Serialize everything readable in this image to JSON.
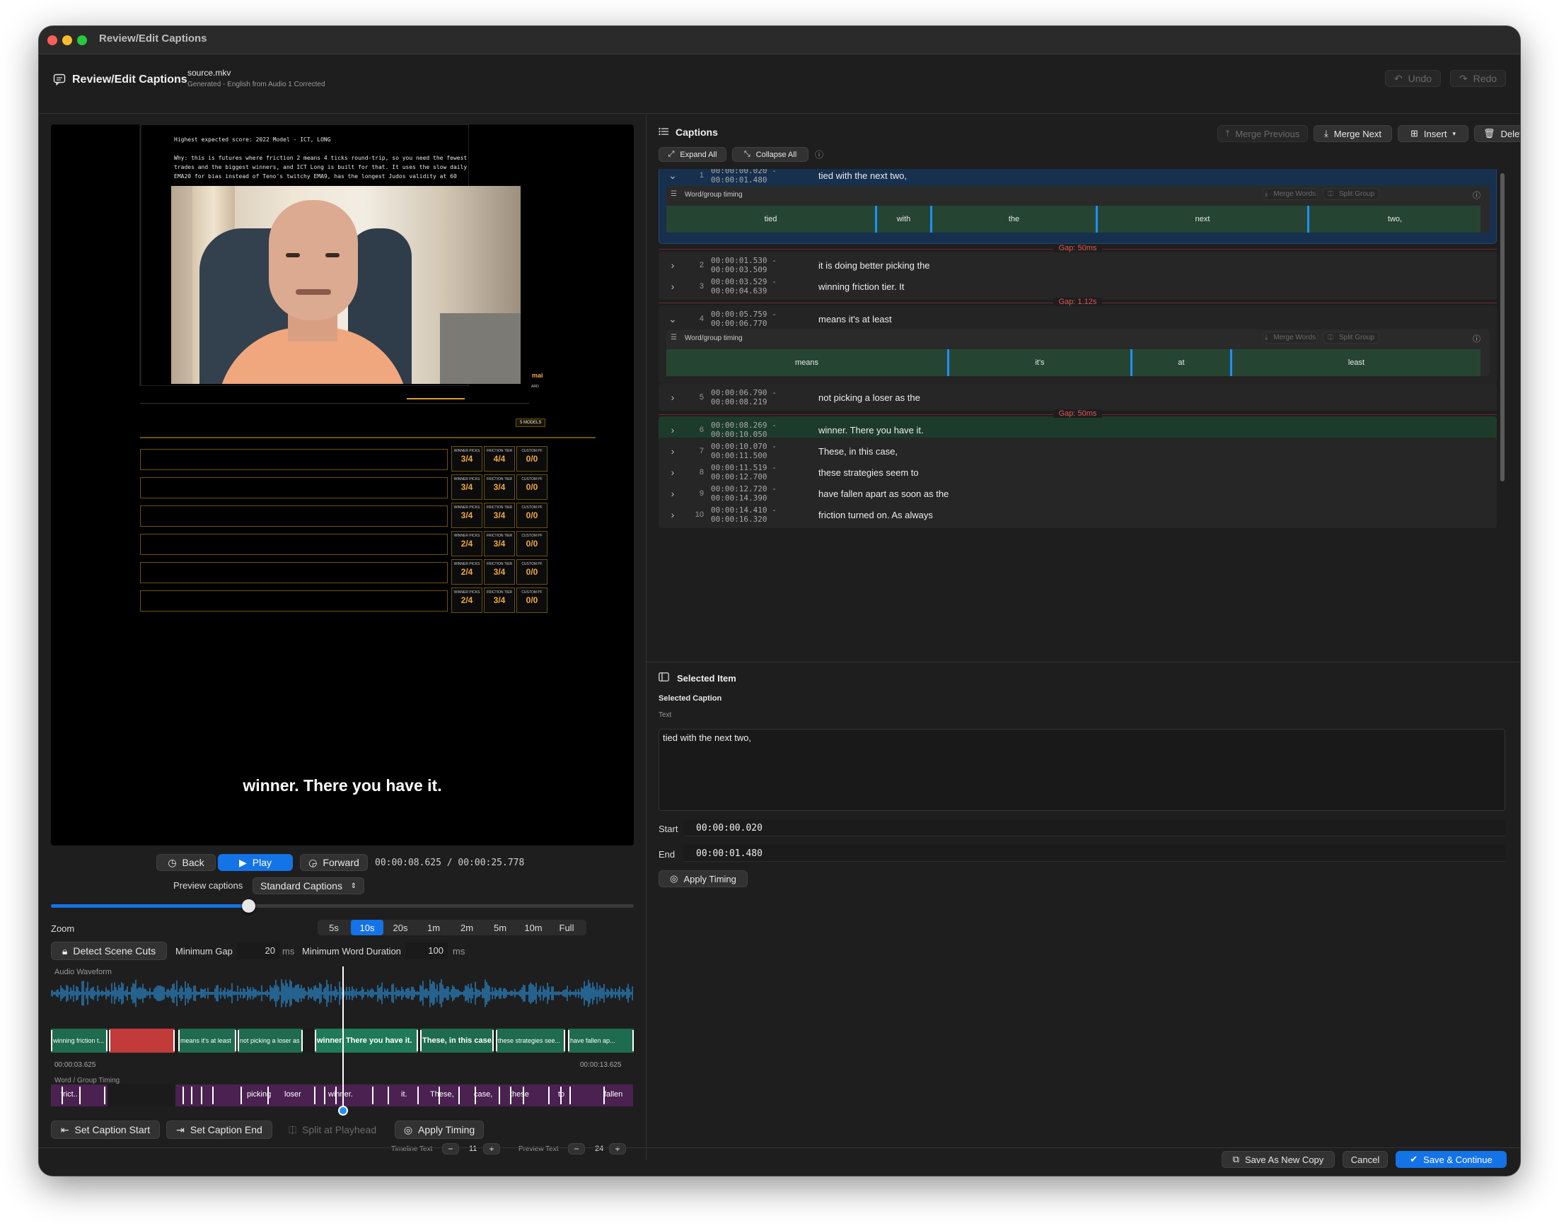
{
  "window": {
    "title": "Review/Edit Captions"
  },
  "header": {
    "title": "Review/Edit Captions",
    "file_name": "source.mkv",
    "file_subtitle": "Generated - English from Audio 1 Corrected",
    "undo_label": "Undo",
    "redo_label": "Redo"
  },
  "video": {
    "overlay_line1": "Highest expected score: 2022 Model - ICT, LONG",
    "overlay_line2": "Why: this is futures where friction 2 means 4 ticks round-trip, so you need the fewest",
    "overlay_line3": "trades and the biggest winners, and ICT Long is built for that. It uses the slow daily",
    "overlay_line4": "EMA20 for bias instead of Teno's twitchy EMA9, has the longest Judos validity at 60",
    "side_tag": "mai",
    "side_tag2": "ARD",
    "models_badge": "5 MODELS",
    "stat_rows": [
      [
        "3/4",
        "4/4",
        "0/0"
      ],
      [
        "3/4",
        "3/4",
        "0/0"
      ],
      [
        "3/4",
        "3/4",
        "0/0"
      ],
      [
        "2/4",
        "3/4",
        "0/0"
      ],
      [
        "2/4",
        "3/4",
        "0/0"
      ],
      [
        "2/4",
        "3/4",
        "0/0"
      ]
    ],
    "stat_titles": [
      "WINNER PICKS",
      "FRICTION TIER",
      "CUSTOM PF"
    ],
    "subtitle": "winner. There you have it."
  },
  "transport": {
    "back_label": "Back",
    "play_label": "Play",
    "forward_label": "Forward",
    "timecode": "00:00:08.625 / 00:00:25.778",
    "preview_label": "Preview captions",
    "preview_select": "Standard Captions",
    "position_fraction": 0.338
  },
  "zoom": {
    "label": "Zoom",
    "options": [
      "5s",
      "10s",
      "20s",
      "1m",
      "2m",
      "5m",
      "10m",
      "Full"
    ],
    "selected": "10s"
  },
  "settings": {
    "detect_label": "Detect Scene Cuts",
    "min_gap_label": "Minimum Gap",
    "min_gap_value": "20",
    "min_gap_unit": "ms",
    "min_word_label": "Minimum Word Duration",
    "min_word_value": "100",
    "min_word_unit": "ms"
  },
  "timeline": {
    "waveform_label": "Audio Waveform",
    "segments": [
      "winning friction t...",
      "",
      "means it's at least",
      "not picking a loser as the",
      "winner. There you have it.",
      "These, in this case,",
      "these strategies see...",
      "have fallen ap..."
    ],
    "start_time": "00:00:03.625",
    "end_time": "00:00:13.625",
    "word_group_label": "Word / Group Timing",
    "words": [
      "frict..",
      "picking",
      "loser",
      "winner.",
      "it.",
      "These,",
      "case,",
      "these",
      "to",
      "fallen"
    ]
  },
  "actions": {
    "set_start": "Set Caption Start",
    "set_end": "Set Caption End",
    "split": "Split at Playhead",
    "apply": "Apply Timing",
    "timeline_text_label": "Timeline Text",
    "timeline_text_value": "11",
    "preview_text_label": "Preview Text",
    "preview_text_value": "24"
  },
  "captions": {
    "title": "Captions",
    "merge_previous": "Merge Previous",
    "merge_next": "Merge Next",
    "insert": "Insert",
    "delete": "Delete",
    "expand_all": "Expand All",
    "collapse_all": "Collapse All",
    "word_timing_label": "Word/group timing",
    "merge_words": "Merge Words",
    "split_group": "Split Group",
    "items": [
      {
        "num": "1",
        "time": "00:00:00.020 - 00:00:01.480",
        "text": "tied with the next two,",
        "words": [
          "tied",
          "with",
          "the",
          "next",
          "two,"
        ]
      },
      {
        "num": "2",
        "time": "00:00:01.530 - 00:00:03.509",
        "text": "it is doing better picking the"
      },
      {
        "num": "3",
        "time": "00:00:03.529 - 00:00:04.639",
        "text": "winning friction tier. It"
      },
      {
        "num": "4",
        "time": "00:00:05.759 - 00:00:06.770",
        "text": "means it's at least",
        "words": [
          "means",
          "it's",
          "at",
          "least"
        ]
      },
      {
        "num": "5",
        "time": "00:00:06.790 - 00:00:08.219",
        "text": "not picking a loser as the"
      },
      {
        "num": "6",
        "time": "00:00:08.269 - 00:00:10.050",
        "text": "winner. There you have it."
      },
      {
        "num": "7",
        "time": "00:00:10.070 - 00:00:11.500",
        "text": "These, in this case,"
      },
      {
        "num": "8",
        "time": "00:00:11.519 - 00:00:12.700",
        "text": "these strategies seem to"
      },
      {
        "num": "9",
        "time": "00:00:12.720 - 00:00:14.390",
        "text": "have fallen apart as soon as the"
      },
      {
        "num": "10",
        "time": "00:00:14.410 - 00:00:16.320",
        "text": "friction turned on. As always"
      }
    ],
    "gaps": [
      "Gap: 50ms",
      "Gap: 1.12s",
      "Gap: 50ms"
    ]
  },
  "selected": {
    "section_title": "Selected Item",
    "caption_title": "Selected Caption",
    "text_label": "Text",
    "text_value": "tied with the next two,",
    "start_label": "Start",
    "start_value": "00:00:00.020",
    "end_label": "End",
    "end_value": "00:00:01.480",
    "apply_label": "Apply Timing"
  },
  "footer": {
    "save_copy": "Save As New Copy",
    "cancel": "Cancel",
    "save_continue": "Save & Continue"
  },
  "colors": {
    "accent": "#1473e6",
    "caption_green": "#1f6b4f",
    "selected_row": "#17304d",
    "gap_red": "#e25555",
    "word_purple": "#4a2150"
  }
}
